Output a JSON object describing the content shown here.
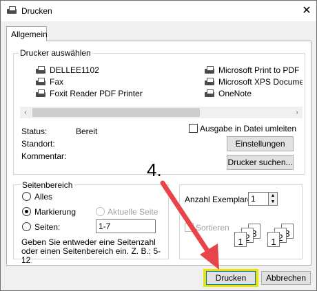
{
  "window": {
    "title": "Drucken",
    "close_glyph": "✕"
  },
  "tabs": [
    {
      "label": "Allgemein"
    }
  ],
  "printer_select": {
    "group_label": "Drucker auswählen",
    "printers_left": [
      "DELLEE1102",
      "Fax",
      "Foxit Reader PDF Printer"
    ],
    "printers_right": [
      "Microsoft Print to PDF",
      "Microsoft XPS Document Writer",
      "OneNote"
    ],
    "scroll_left_glyph": "‹",
    "scroll_right_glyph": "›",
    "status_label": "Status:",
    "status_value": "Bereit",
    "location_label": "Standort:",
    "comment_label": "Kommentar:",
    "print_to_file_label": "Ausgabe in Datei umleiten",
    "preferences_button": "Einstellungen",
    "find_printer_button": "Drucker suchen..."
  },
  "page_range": {
    "group_label": "Seitenbereich",
    "all_label": "Alles",
    "selection_label": "Markierung",
    "current_page_label": "Aktuelle Seite",
    "pages_label": "Seiten:",
    "pages_value": "1-7",
    "hint": "Geben Sie entweder eine Seitenzahl oder einen Seitenbereich ein. Z. B.: 5-12"
  },
  "copies": {
    "count_label": "Anzahl Exemplare:",
    "count_value": "1",
    "collate_label": "Sortieren",
    "collate_pages": [
      "1",
      "2",
      "3"
    ]
  },
  "annotation": {
    "step_label": "4.",
    "arrow_color": "#e8454a",
    "highlight_color": "#e6e600"
  },
  "buttons": {
    "print": "Drucken",
    "cancel": "Abbrechen"
  }
}
